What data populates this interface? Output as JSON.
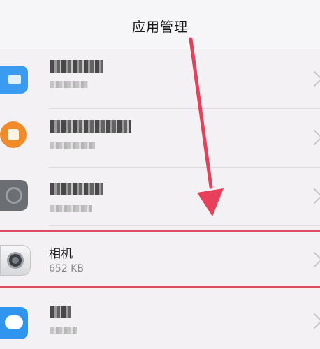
{
  "header": {
    "title": "应用管理"
  },
  "apps": [
    {
      "name": "",
      "size": "",
      "icon": "blue-app-icon",
      "color": "#3a9bf0",
      "blurred": true
    },
    {
      "name": "",
      "size": "",
      "icon": "orange-app-icon",
      "color": "#f08a2a",
      "blurred": true
    },
    {
      "name": "",
      "size": "",
      "icon": "gray-app-icon",
      "color": "#6b6f73",
      "blurred": true
    },
    {
      "name": "相机",
      "size": "652 KB",
      "icon": "camera-icon",
      "color": "#3b3f45",
      "blurred": false
    },
    {
      "name": "",
      "size": "",
      "icon": "message-bubble-icon",
      "color": "#2f95ef",
      "blurred": true
    }
  ],
  "annotation": {
    "highlight_color": "#e04a63",
    "arrow_color": "#e8405a"
  }
}
